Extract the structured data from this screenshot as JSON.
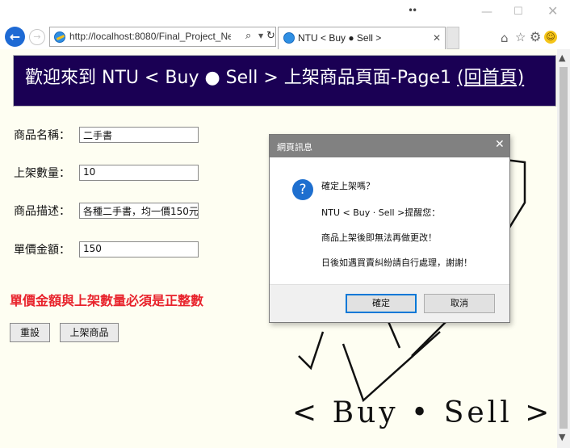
{
  "browser": {
    "address": "http://localhost:8080/Final_Project_New",
    "tab_title": "NTU < Buy ● Sell >",
    "title_dots": "••",
    "window_buttons": {
      "minimize": "—",
      "maximize": "☐",
      "close": "✕"
    }
  },
  "page": {
    "banner_title": "歡迎來到 NTU < Buy ● Sell > 上架商品頁面-Page1",
    "banner_link": "(回首頁)",
    "form": {
      "name_label": "商品名稱：",
      "name_value": "二手書",
      "quantity_label": "上架數量：",
      "quantity_value": "10",
      "desc_label": "商品描述：",
      "desc_value": "各種二手書，均一價150元",
      "price_label": "單價金額：",
      "price_value": "150"
    },
    "error_message": "單價金額與上架數量必須是正整數",
    "reset_button": "重設",
    "submit_button": "上架商品",
    "logo_text": "< Buy • Sell >"
  },
  "dialog": {
    "title": "網頁訊息",
    "lines": [
      "確定上架嗎？",
      "NTU < Buy · Sell >提醒您：",
      "商品上架後即無法再做更改！",
      "日後如遇買賣糾紛請自行處理，謝謝！"
    ],
    "ok_button": "確定",
    "cancel_button": "取消"
  },
  "icons": {
    "back": "arrow-left-icon",
    "forward": "arrow-right-icon",
    "question": "question-icon"
  },
  "colors": {
    "banner_bg": "#1a0054",
    "error_text": "#e8232c",
    "page_bg": "#fefef2",
    "accent": "#1e6ad4"
  }
}
